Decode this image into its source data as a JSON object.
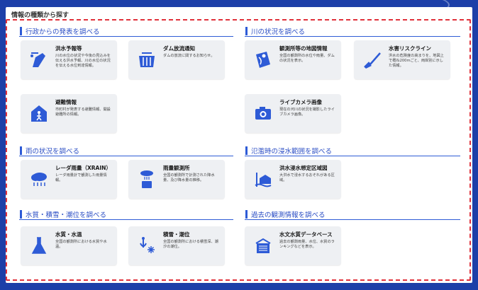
{
  "panel_title": "情報の種類から探す",
  "colors": {
    "accent": "#2e5bd6",
    "icon": "#2e5bd6",
    "dashed": "#e0303a",
    "page_bg": "#1d3fa8"
  },
  "sections": [
    {
      "label": "行政からの発表を調べる",
      "cards": [
        {
          "title": "洪水予報等",
          "desc": "川の水位の状況や今後の見込みを伝える洪水予報、川の水位の状況を伝える水位到達情報。",
          "icon": "flood-forecast-icon"
        },
        {
          "title": "ダム放流通知",
          "desc": "ダムの放流に関するお知らせ。",
          "icon": "dam-release-icon"
        },
        {
          "title": "避難情報",
          "desc": "市町村が発表する避難情報、開設避難所の情報。",
          "icon": "evacuation-icon"
        }
      ]
    },
    {
      "label": "川の状況を調べる",
      "cards": [
        {
          "title": "観測所等の地図情報",
          "desc": "全国の観測所の水位や雨量、ダムの状況を表示。",
          "icon": "map-info-icon"
        },
        {
          "title": "水害リスクライン",
          "desc": "洪水の危険度の高まりを、地図上で概ね200mごと、両岸別に示した情報。",
          "icon": "risk-line-icon"
        },
        {
          "title": "ライブカメラ画像",
          "desc": "現在の河川の状況を撮影したライブカメラ画像。",
          "icon": "camera-icon"
        }
      ]
    },
    {
      "label": "雨の状況を調べる",
      "cards": [
        {
          "title": "レーダ雨量（XRAIN）",
          "desc": "レーダ雨量計で観測した雨量情報。",
          "icon": "radar-rain-icon"
        },
        {
          "title": "雨量観測所",
          "desc": "全国の観測所で計測された降水量、及び降水量の推移。",
          "icon": "rain-gauge-icon"
        }
      ]
    },
    {
      "label": "氾濫時の浸水範囲を調べる",
      "cards": [
        {
          "title": "洪水浸水想定区域図",
          "desc": "大洪水で浸水するおそれがある区域。",
          "icon": "inundation-map-icon"
        }
      ]
    },
    {
      "label": "水質・積雪・潮位を調べる",
      "cards": [
        {
          "title": "水質・水温",
          "desc": "全国の観測所における水質や水温。",
          "icon": "water-quality-icon"
        },
        {
          "title": "積雪・潮位",
          "desc": "全国の観測所における積雪深、潮汐の潮位。",
          "icon": "snow-tide-icon"
        }
      ]
    },
    {
      "label": "過去の観測情報を調べる",
      "cards": [
        {
          "title": "水文水質データベース",
          "desc": "過去の観測雨量、水位、水質のランキングなどを表示。",
          "icon": "database-icon"
        }
      ]
    }
  ]
}
